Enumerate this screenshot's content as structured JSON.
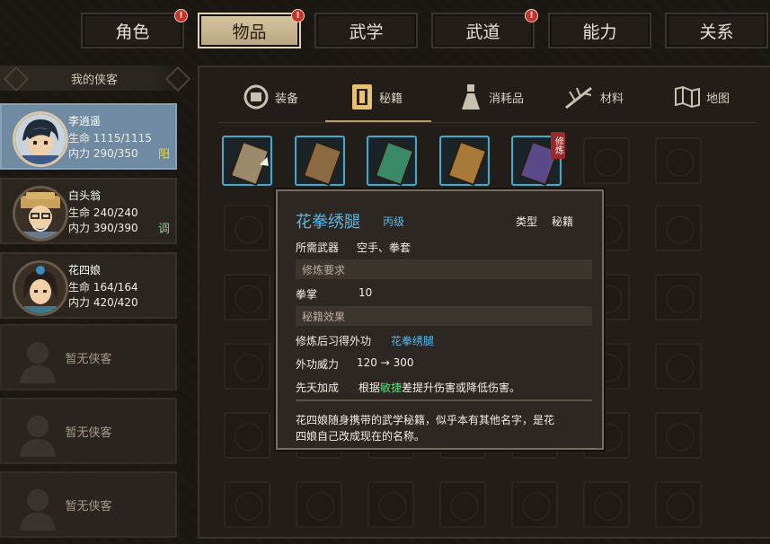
{
  "top_tabs": [
    {
      "label": "角色",
      "badge": "!"
    },
    {
      "label": "物品",
      "badge": "!"
    },
    {
      "label": "武学",
      "badge": ""
    },
    {
      "label": "武道",
      "badge": "!"
    },
    {
      "label": "能力",
      "badge": ""
    },
    {
      "label": "关系",
      "badge": ""
    }
  ],
  "sidebar": {
    "header": "我的侠客",
    "heroes": [
      {
        "name": "李逍遥",
        "hp": "生命 1115/1115",
        "mp": "内力 290/350",
        "tag": "阳",
        "tag_color": "#e6d24a"
      },
      {
        "name": "白头翁",
        "hp": "生命 240/240",
        "mp": "内力 390/390",
        "tag": "调",
        "tag_color": "#7fd27a"
      },
      {
        "name": "花四娘",
        "hp": "生命 164/164",
        "mp": "内力 420/420",
        "tag": "",
        "tag_color": "#ffffff"
      }
    ],
    "empty_label": "暂无侠客"
  },
  "item_tabs": [
    "装备",
    "秘籍",
    "消耗品",
    "材料",
    "地图"
  ],
  "items": [
    {
      "icon": "scroll-book-icon",
      "color": "#9a8a6a"
    },
    {
      "icon": "brown-book-icon",
      "color": "#8a6a40"
    },
    {
      "icon": "green-book-icon",
      "color": "#3a8a6a"
    },
    {
      "icon": "tan-book-icon",
      "color": "#a87a3a"
    },
    {
      "icon": "purple-book-icon",
      "color": "#5a4a8a",
      "badge": "修炼"
    }
  ],
  "tooltip": {
    "title": "花拳绣腿",
    "grade": "丙级",
    "type_label": "类型",
    "type_value": "秘籍",
    "weapon_label": "所需武器",
    "weapon_value": "空手、拳套",
    "req_header": "修炼要求",
    "req_label": "拳掌",
    "req_value": "10",
    "effect_header": "秘籍效果",
    "learn_label": "修炼后习得外功",
    "learn_value": "花拳绣腿",
    "power_label": "外功威力",
    "power_value": "120 → 300",
    "innate_label": "先天加成",
    "innate_prefix": "根据",
    "innate_key": "敏捷",
    "innate_suffix": "差提升伤害或降低伤害。",
    "desc_line1": "花四娘随身携带的武学秘籍，似乎本有其他名字，是花",
    "desc_line2": "四娘自己改成现在的名称。"
  }
}
